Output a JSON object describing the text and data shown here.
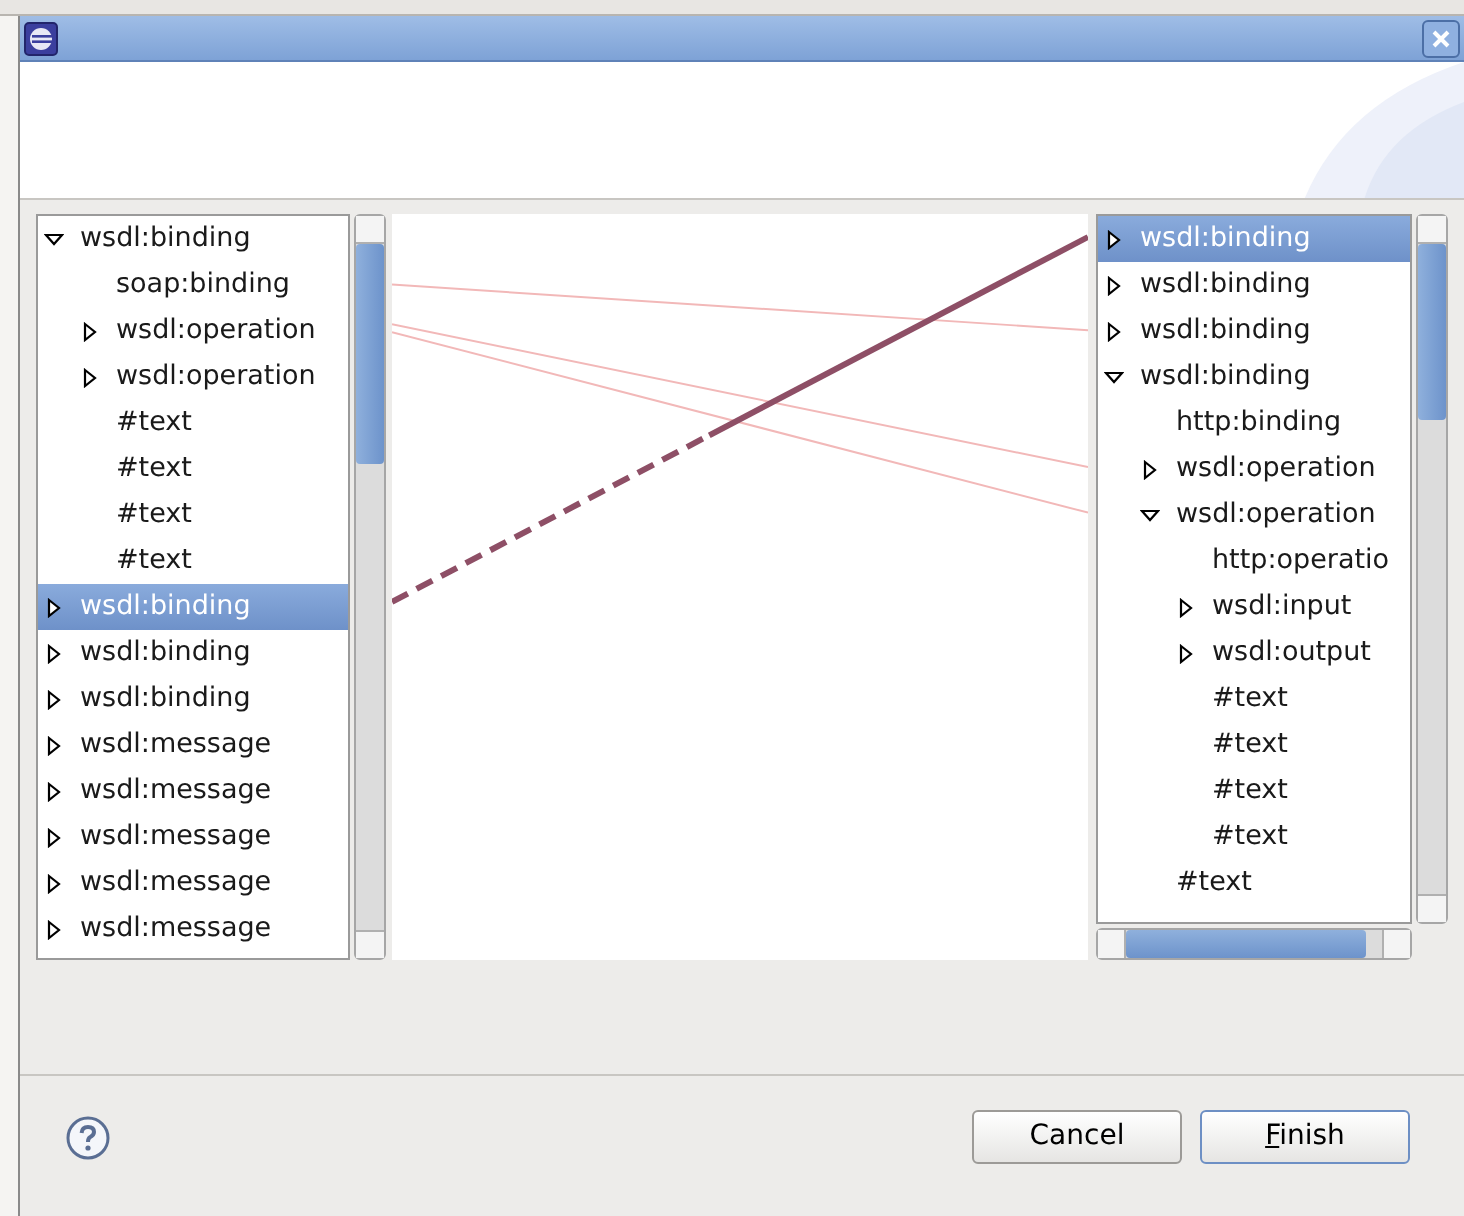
{
  "left_tree": {
    "items": [
      {
        "label": "wsdl:binding",
        "selected": false,
        "expanded": true,
        "children": [
          {
            "label": "soap:binding",
            "selected": false
          },
          {
            "label": "wsdl:operation",
            "selected": false,
            "expanded": false
          },
          {
            "label": "wsdl:operation",
            "selected": false,
            "expanded": false
          },
          {
            "label": "#text",
            "selected": false
          },
          {
            "label": "#text",
            "selected": false
          },
          {
            "label": "#text",
            "selected": false
          },
          {
            "label": "#text",
            "selected": false
          }
        ]
      },
      {
        "label": "wsdl:binding",
        "selected": true,
        "expanded": false
      },
      {
        "label": "wsdl:binding",
        "selected": false,
        "expanded": false
      },
      {
        "label": "wsdl:binding",
        "selected": false,
        "expanded": false
      },
      {
        "label": "wsdl:message",
        "selected": false,
        "expanded": false
      },
      {
        "label": "wsdl:message",
        "selected": false,
        "expanded": false
      },
      {
        "label": "wsdl:message",
        "selected": false,
        "expanded": false
      },
      {
        "label": "wsdl:message",
        "selected": false,
        "expanded": false
      },
      {
        "label": "wsdl:message",
        "selected": false,
        "expanded": false
      }
    ]
  },
  "right_tree": {
    "items": [
      {
        "label": "wsdl:binding",
        "selected": true,
        "expanded": false
      },
      {
        "label": "wsdl:binding",
        "selected": false,
        "expanded": false
      },
      {
        "label": "wsdl:binding",
        "selected": false,
        "expanded": false
      },
      {
        "label": "wsdl:binding",
        "selected": false,
        "expanded": true,
        "children": [
          {
            "label": "http:binding",
            "selected": false
          },
          {
            "label": "wsdl:operation",
            "selected": false,
            "expanded": false
          },
          {
            "label": "wsdl:operation",
            "selected": false,
            "expanded": true,
            "children": [
              {
                "label": "http:operatio",
                "selected": false
              },
              {
                "label": "wsdl:input",
                "selected": false,
                "expanded": false
              },
              {
                "label": "wsdl:output",
                "selected": false,
                "expanded": false
              },
              {
                "label": "#text",
                "selected": false
              },
              {
                "label": "#text",
                "selected": false
              },
              {
                "label": "#text",
                "selected": false
              },
              {
                "label": "#text",
                "selected": false
              }
            ]
          },
          {
            "label": "#text",
            "selected": false
          }
        ]
      }
    ]
  },
  "buttons": [
    {
      "label": "Cancel",
      "default": false
    },
    {
      "label": "Finish",
      "default": true
    }
  ]
}
